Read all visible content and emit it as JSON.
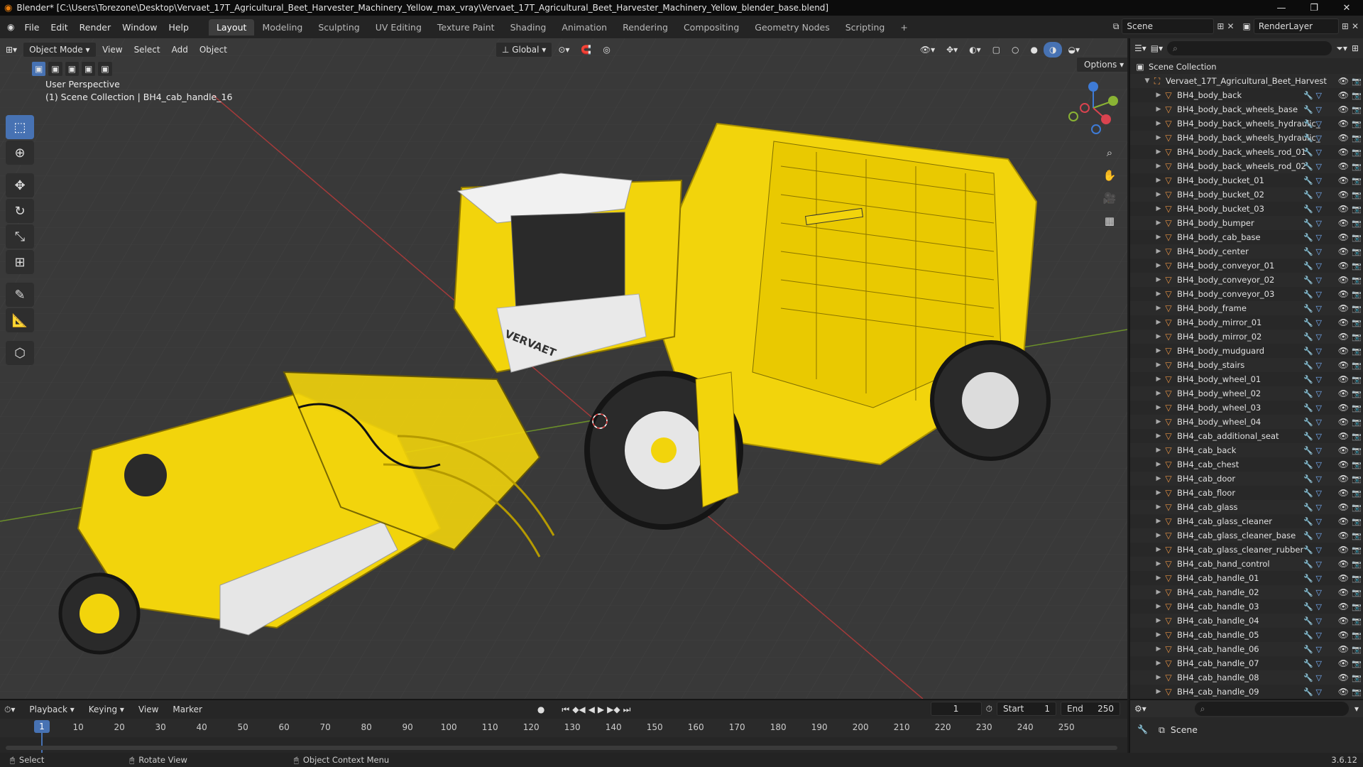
{
  "title": "Blender* [C:\\Users\\Torezone\\Desktop\\Vervaet_17T_Agricultural_Beet_Harvester_Machinery_Yellow_max_vray\\Vervaet_17T_Agricultural_Beet_Harvester_Machinery_Yellow_blender_base.blend]",
  "menu": [
    "File",
    "Edit",
    "Render",
    "Window",
    "Help"
  ],
  "workspaces": [
    "Layout",
    "Modeling",
    "Sculpting",
    "UV Editing",
    "Texture Paint",
    "Shading",
    "Animation",
    "Rendering",
    "Compositing",
    "Geometry Nodes",
    "Scripting"
  ],
  "active_workspace": "Layout",
  "scene": "Scene",
  "render_layer": "RenderLayer",
  "viewport": {
    "mode": "Object Mode",
    "menus": [
      "View",
      "Select",
      "Add",
      "Object"
    ],
    "orientation": "Global",
    "options": "Options",
    "perspective": "User Perspective",
    "collection_info": "(1) Scene Collection | BH4_cab_handle_16",
    "brand_text": "VERVAET"
  },
  "outliner": {
    "root": "Scene Collection",
    "collection": "Vervaet_17T_Agricultural_Beet_Harvest",
    "items": [
      "BH4_body_back",
      "BH4_body_back_wheels_base",
      "BH4_body_back_wheels_hydraulic_",
      "BH4_body_back_wheels_hydraulic_",
      "BH4_body_back_wheels_rod_01",
      "BH4_body_back_wheels_rod_02",
      "BH4_body_bucket_01",
      "BH4_body_bucket_02",
      "BH4_body_bucket_03",
      "BH4_body_bumper",
      "BH4_body_cab_base",
      "BH4_body_center",
      "BH4_body_conveyor_01",
      "BH4_body_conveyor_02",
      "BH4_body_conveyor_03",
      "BH4_body_frame",
      "BH4_body_mirror_01",
      "BH4_body_mirror_02",
      "BH4_body_mudguard",
      "BH4_body_stairs",
      "BH4_body_wheel_01",
      "BH4_body_wheel_02",
      "BH4_body_wheel_03",
      "BH4_body_wheel_04",
      "BH4_cab_additional_seat",
      "BH4_cab_back",
      "BH4_cab_chest",
      "BH4_cab_door",
      "BH4_cab_floor",
      "BH4_cab_glass",
      "BH4_cab_glass_cleaner",
      "BH4_cab_glass_cleaner_base",
      "BH4_cab_glass_cleaner_rubber",
      "BH4_cab_hand_control",
      "BH4_cab_handle_01",
      "BH4_cab_handle_02",
      "BH4_cab_handle_03",
      "BH4_cab_handle_04",
      "BH4_cab_handle_05",
      "BH4_cab_handle_06",
      "BH4_cab_handle_07",
      "BH4_cab_handle_08",
      "BH4_cab_handle_09"
    ]
  },
  "timeline": {
    "menus": [
      "Playback",
      "Keying",
      "View",
      "Marker"
    ],
    "current_frame": "1",
    "start_label": "Start",
    "start": "1",
    "end_label": "End",
    "end": "250",
    "ticks": [
      "10",
      "20",
      "30",
      "40",
      "50",
      "60",
      "70",
      "80",
      "90",
      "100",
      "110",
      "120",
      "130",
      "140",
      "150",
      "160",
      "170",
      "180",
      "190",
      "200",
      "210",
      "220",
      "230",
      "240",
      "250"
    ]
  },
  "properties": {
    "scene": "Scene"
  },
  "status": {
    "select": "Select",
    "rotate": "Rotate View",
    "context": "Object Context Menu",
    "version": "3.6.12"
  },
  "colors": {
    "accent": "#4772b3",
    "machine_yellow": "#f2d40c",
    "object_orange": "#e69245"
  }
}
